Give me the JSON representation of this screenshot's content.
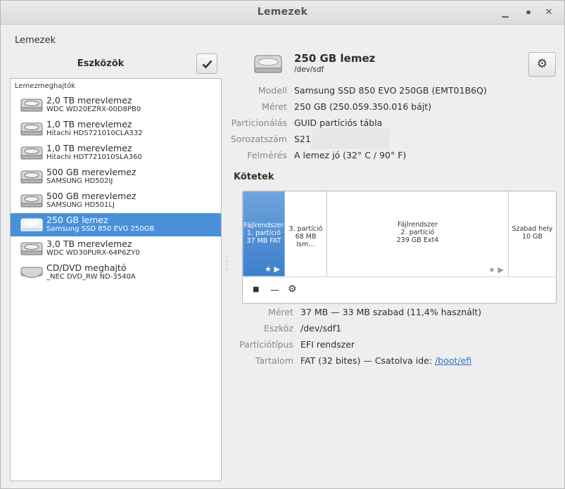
{
  "window": {
    "title": "Lemezek"
  },
  "menu": {
    "app_label": "Lemezek"
  },
  "sidebar": {
    "header": "Eszközök",
    "group_label": "Lemezmeghajtók",
    "devices": [
      {
        "name": "2,0 TB merevlemez",
        "model": "WDC WD20EZRX-00D8PB0",
        "icon": "harddisk-icon",
        "selected": false
      },
      {
        "name": "1,0 TB merevlemez",
        "model": "Hitachi HDS721010CLA332",
        "icon": "harddisk-icon",
        "selected": false
      },
      {
        "name": "1,0 TB merevlemez",
        "model": "Hitachi HDT721010SLA360",
        "icon": "harddisk-icon",
        "selected": false
      },
      {
        "name": "500 GB merevlemez",
        "model": "SAMSUNG HD502IJ",
        "icon": "harddisk-icon",
        "selected": false
      },
      {
        "name": "500 GB merevlemez",
        "model": "SAMSUNG HD501LJ",
        "icon": "harddisk-icon",
        "selected": false
      },
      {
        "name": "250 GB lemez",
        "model": "Samsung SSD 850 EVO 250GB",
        "icon": "harddisk-icon",
        "selected": true
      },
      {
        "name": "3,0 TB merevlemez",
        "model": "WDC WD30PURX-64P6ZY0",
        "icon": "harddisk-icon",
        "selected": false
      },
      {
        "name": "CD/DVD meghajtó",
        "model": "_NEC DVD_RW ND-3540A",
        "icon": "optical-drive-icon",
        "selected": false
      }
    ]
  },
  "disk": {
    "title": "250 GB lemez",
    "device": "/dev/sdf",
    "props": [
      {
        "label": "Modell",
        "value": "Samsung SSD 850 EVO 250GB (EMT01B6Q)"
      },
      {
        "label": "Méret",
        "value": "250 GB (250.059.350.016 bájt)"
      },
      {
        "label": "Particionálás",
        "value": "GUID partíciós tábla"
      },
      {
        "label": "Sorozatszám",
        "value": "S21"
      },
      {
        "label": "Felmérés",
        "value": "A lemez jó (32° C / 90° F)"
      }
    ]
  },
  "volumes": {
    "header": "Kötetek",
    "segments": [
      {
        "line1": "Fájlrendszer",
        "line2": "1. partíció",
        "line3": "37 MB FAT",
        "selected": true
      },
      {
        "line1": "",
        "line2": "3. partíció",
        "line3": "68 MB Ism…",
        "selected": false
      },
      {
        "line1": "Fájlrendszer",
        "line2": "2. partíció",
        "line3": "239 GB Ext4",
        "selected": false
      },
      {
        "line1": "",
        "line2": "Szabad hely",
        "line3": "10 GB",
        "selected": false
      }
    ],
    "marks": "★ ▶",
    "tools": {
      "stop": "■",
      "remove": "—",
      "settings": "⚙"
    }
  },
  "partition": {
    "props": [
      {
        "label": "Méret",
        "value": "37 MB — 33 MB szabad (11,4% használt)"
      },
      {
        "label": "Eszköz",
        "value": "/dev/sdf1"
      },
      {
        "label": "Partíciótípus",
        "value": "EFI rendszer"
      },
      {
        "label": "Tartalom",
        "value": "FAT (32 bites) — Csatolva ide:",
        "link": "/boot/efi"
      }
    ]
  },
  "colors": {
    "selection": "#4a90d9",
    "link": "#2a76c6"
  }
}
